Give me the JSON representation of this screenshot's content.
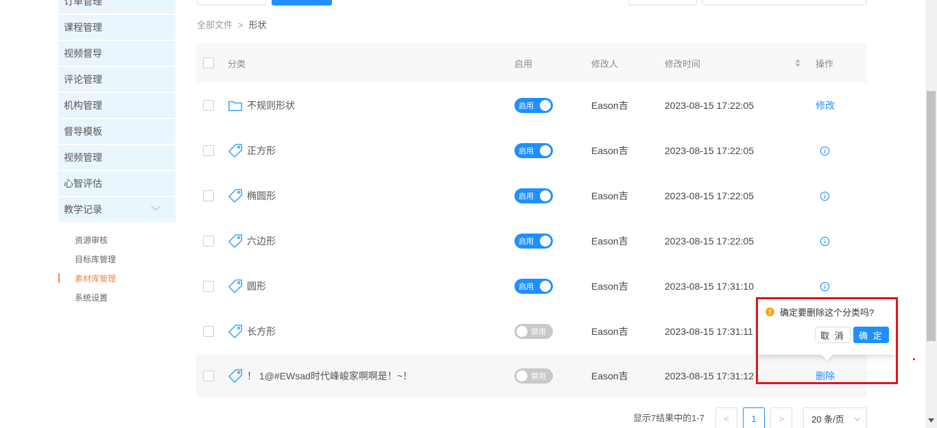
{
  "sidebar": {
    "items": [
      {
        "label": "订单管理"
      },
      {
        "label": "课程管理"
      },
      {
        "label": "视频督导"
      },
      {
        "label": "评论管理"
      },
      {
        "label": "机构管理"
      },
      {
        "label": "督导模板"
      },
      {
        "label": "视频管理"
      },
      {
        "label": "心智评估"
      },
      {
        "label": "教学记录"
      }
    ],
    "sub_items": [
      {
        "label": "资源审核"
      },
      {
        "label": "目标库管理"
      },
      {
        "label": "素材库管理"
      },
      {
        "label": "系统设置"
      }
    ]
  },
  "breadcrumb": {
    "root": "全部文件",
    "sep": ">",
    "current": "形状"
  },
  "table": {
    "headers": {
      "category": "分类",
      "enabled": "启用",
      "modifier": "修改人",
      "modified_time": "修改时间",
      "action": "操作"
    },
    "rows": [
      {
        "name": "不规则形状",
        "icon": "folder-icon",
        "switch": "启用",
        "user": "Eason吉",
        "time": "2023-08-15 17:22:05",
        "op": "修改"
      },
      {
        "name": "正方形",
        "icon": "tag-icon",
        "switch": "启用",
        "user": "Eason吉",
        "time": "2023-08-15 17:22:05",
        "op": ""
      },
      {
        "name": "椭圆形",
        "icon": "tag-icon",
        "switch": "启用",
        "user": "Eason吉",
        "time": "2023-08-15 17:22:05",
        "op": ""
      },
      {
        "name": "六边形",
        "icon": "tag-icon",
        "switch": "启用",
        "user": "Eason吉",
        "time": "2023-08-15 17:22:05",
        "op": ""
      },
      {
        "name": "圆形",
        "icon": "tag-icon",
        "switch": "启用",
        "user": "Eason吉",
        "time": "2023-08-15 17:31:10",
        "op": ""
      },
      {
        "name": "长方形",
        "icon": "tag-icon",
        "switch": "禁用",
        "user": "Eason吉",
        "time": "2023-08-15 17:31:11",
        "op": ""
      },
      {
        "name": "！ 1@#EWsad时代峰峻家啊啊是！~！",
        "icon": "tag-icon",
        "switch": "禁用",
        "user": "Eason吉",
        "time": "2023-08-15 17:31:12",
        "op": "删除"
      }
    ]
  },
  "popconfirm": {
    "message": "确定要删除这个分类吗?",
    "cancel": "取 消",
    "ok": "确 定"
  },
  "pagination": {
    "info": "显示7结果中的1-7",
    "prev": "<",
    "page": "1",
    "next": ">",
    "size": "20 条/页"
  },
  "colors": {
    "primary": "#1e90ff",
    "highlight": "#e8101b",
    "active_sub": "#e8894a"
  }
}
